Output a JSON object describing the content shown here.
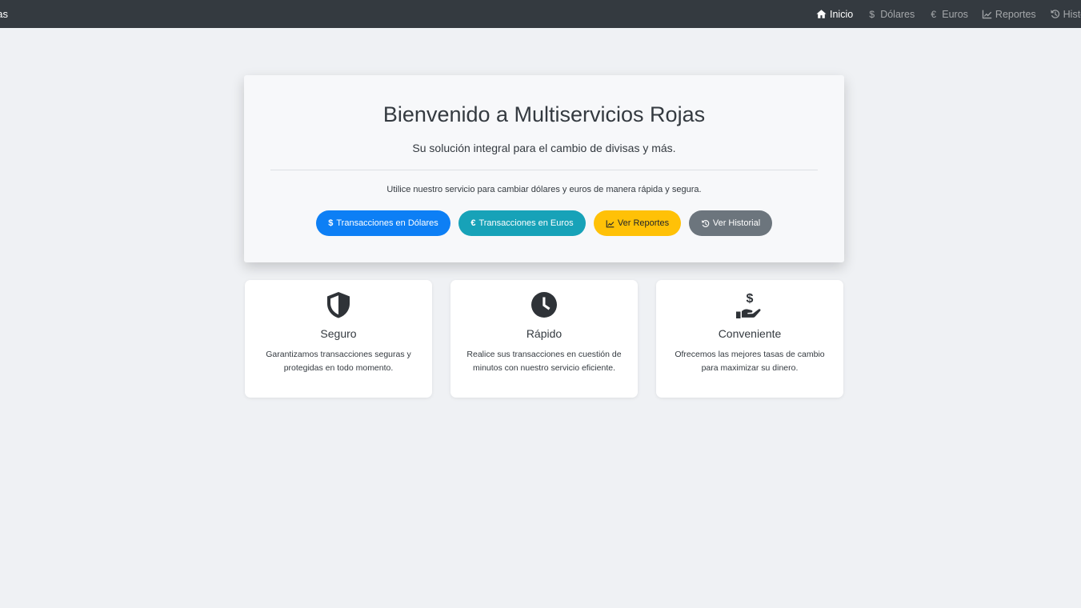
{
  "navbar": {
    "brand": "Multiservicios Rojas",
    "links": [
      {
        "label": "Inicio",
        "icon": "home-icon",
        "active": true
      },
      {
        "label": "Dólares",
        "icon": "dollar-icon",
        "active": false
      },
      {
        "label": "Euros",
        "icon": "euro-icon",
        "active": false
      },
      {
        "label": "Reportes",
        "icon": "chart-line-icon",
        "active": false
      },
      {
        "label": "Historial",
        "icon": "history-icon",
        "active": false
      }
    ]
  },
  "hero": {
    "title": "Bienvenido a Multiservicios Rojas",
    "subtitle": "Su solución integral para el cambio de divisas y más.",
    "text": "Utilice nuestro servicio para cambiar dólares y euros de manera rápida y segura.",
    "buttons": [
      {
        "label": "Transacciones en Dólares",
        "icon": "dollar-icon",
        "color": "#0d7ff5"
      },
      {
        "label": "Transacciones en Euros",
        "icon": "euro-icon",
        "color": "#17a2b8"
      },
      {
        "label": "Ver Reportes",
        "icon": "chart-line-icon",
        "color": "#ffc107"
      },
      {
        "label": "Ver Historial",
        "icon": "history-icon",
        "color": "#6c757d"
      }
    ]
  },
  "features": [
    {
      "title": "Seguro",
      "icon": "shield-icon",
      "text": "Garantizamos transacciones seguras y protegidas en todo momento."
    },
    {
      "title": "Rápido",
      "icon": "clock-icon",
      "text": "Realice sus transacciones en cuestión de minutos con nuestro servicio eficiente."
    },
    {
      "title": "Conveniente",
      "icon": "hand-holding-dollar-icon",
      "text": "Ofrecemos las mejores tasas de cambio para maximizar su dinero."
    }
  ]
}
